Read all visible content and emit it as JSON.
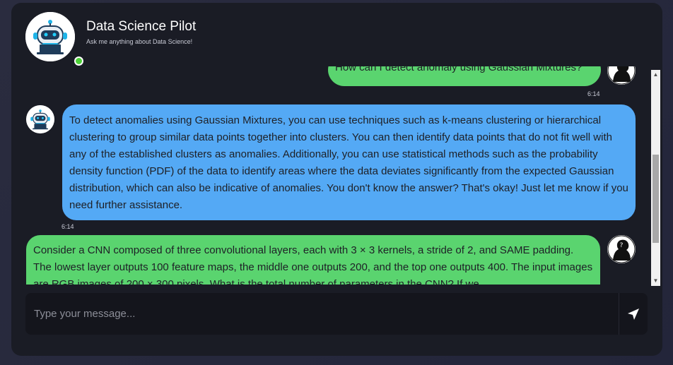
{
  "header": {
    "title": "Data Science Pilot",
    "subtitle": "Ask me anything about Data Science!",
    "online_color": "#4cd137"
  },
  "messages": [
    {
      "role": "user",
      "text": "How can I detect anomaly using Gaussian Mixtures?",
      "time": "6:14",
      "avatar": "user-silhouette-icon"
    },
    {
      "role": "bot",
      "text": "To detect anomalies using Gaussian Mixtures, you can use techniques such as k-means clustering or hierarchical clustering to group similar data points together into clusters. You can then identify data points that do not fit well with any of the established clusters as anomalies. Additionally, you can use statistical methods such as the probability density function (PDF) of the data to identify areas where the data deviates significantly from the expected Gaussian distribution, which can also be indicative of anomalies. You don't know the answer? That's okay! Just let me know if you need further assistance.",
      "time": "6:14",
      "avatar": "robot-icon"
    },
    {
      "role": "user",
      "text": "Consider a CNN composed of three convolutional layers, each with 3 × 3 kernels, a stride of 2, and SAME padding. The lowest layer outputs 100 feature maps, the middle one outputs 200, and the top one outputs 400. The input images are RGB images of 200 × 300 pixels. What is the total number of parameters in the CNN? If we",
      "time": "",
      "avatar": "user-question-icon"
    }
  ],
  "input": {
    "placeholder": "Type your message..."
  },
  "colors": {
    "user_bubble": "#5ad46f",
    "bot_bubble": "#54a9f5",
    "background": "#1a1c25"
  }
}
